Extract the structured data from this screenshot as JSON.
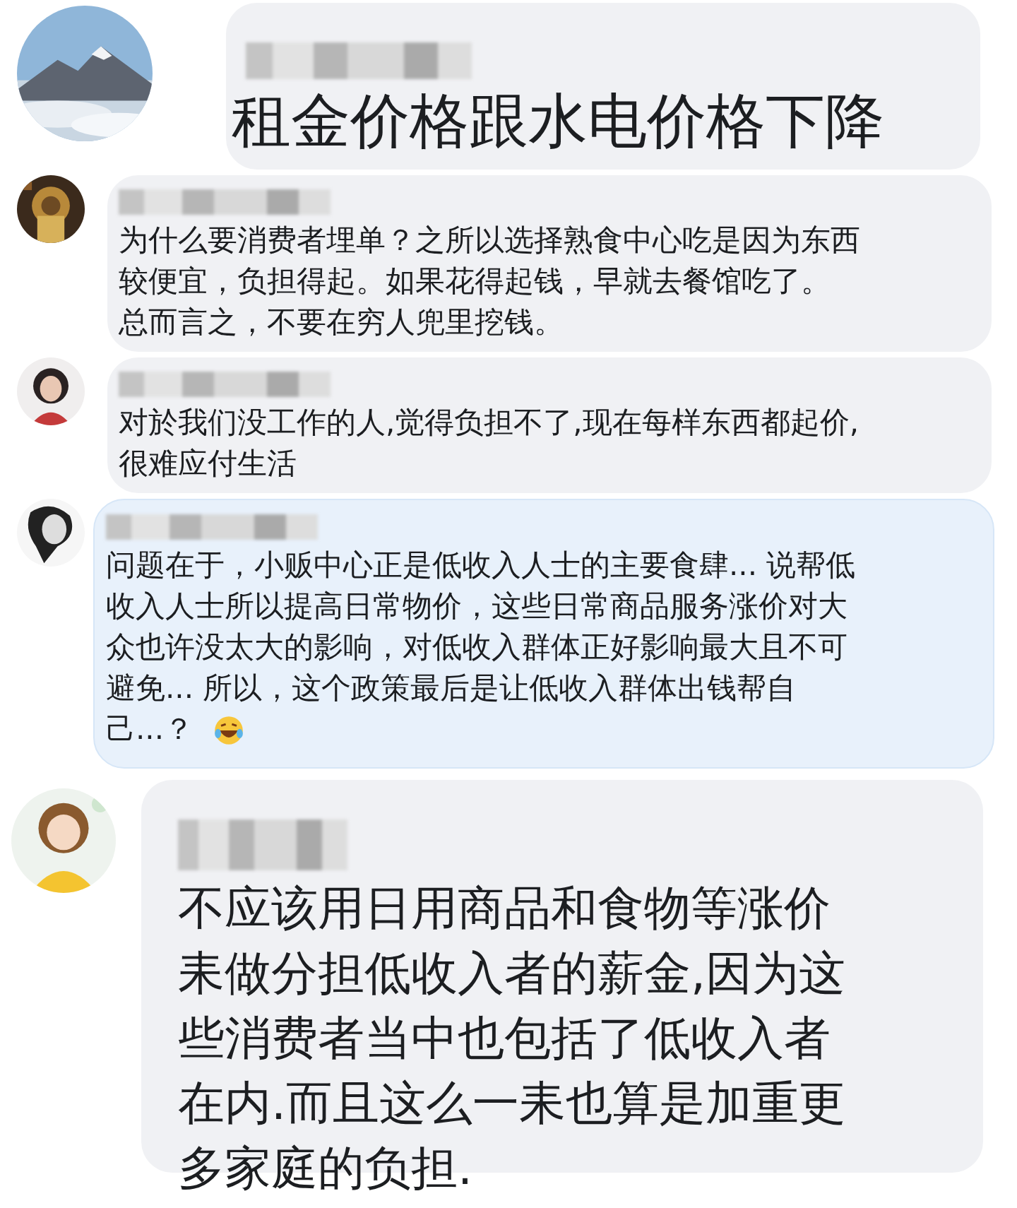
{
  "comments": [
    {
      "highlighted": false,
      "lines": [
        "租金价格跟水电价格下降"
      ]
    },
    {
      "highlighted": false,
      "lines": [
        "为什么要消费者埋单？之所以选择熟食中心吃是因为东西",
        "较便宜，负担得起。如果花得起钱，早就去餐馆吃了。",
        "总而言之，不要在穷人兜里挖钱。"
      ]
    },
    {
      "highlighted": false,
      "lines": [
        "对於我们没工作的人,觉得负担不了,现在每样东西都起价,",
        "很难应付生活"
      ]
    },
    {
      "highlighted": true,
      "has_emoji": true,
      "lines": [
        "问题在于，小贩中心正是低收入人士的主要食肆... 说帮低",
        "收入人士所以提高日常物价，这些日常商品服务涨价对大",
        "众也许没太大的影响，对低收入群体正好影响最大且不可",
        "避免... 所以，这个政策最后是让低收入群体出钱帮自",
        "己...？"
      ]
    },
    {
      "highlighted": false,
      "lines": [
        "不应该用日用商品和食物等涨价",
        "耒做分担低收入者的薪金,因为这",
        "些消费者当中也包括了低收入者",
        "在内.而且这么一耒也算是加重更",
        "多家庭的负担."
      ]
    }
  ]
}
